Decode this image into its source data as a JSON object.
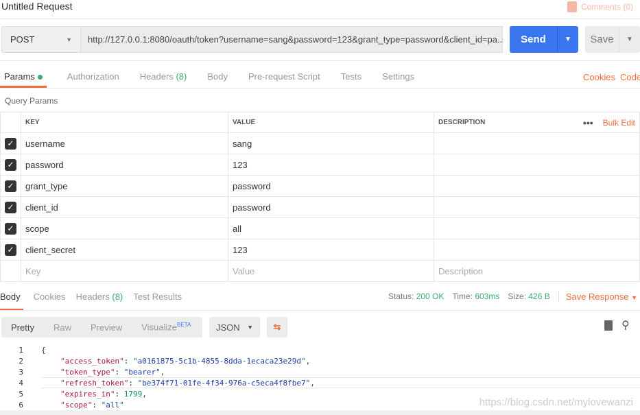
{
  "title": "Untitled Request",
  "comments": "Comments (0)",
  "request": {
    "method": "POST",
    "url": "http://127.0.0.1:8080/oauth/token?username=sang&password=123&grant_type=password&client_id=pa...",
    "send": "Send",
    "save": "Save"
  },
  "tabs": [
    {
      "label": "Params"
    },
    {
      "label": "Authorization"
    },
    {
      "label": "Headers",
      "count": "(8)"
    },
    {
      "label": "Body"
    },
    {
      "label": "Pre-request Script"
    },
    {
      "label": "Tests"
    },
    {
      "label": "Settings"
    }
  ],
  "links": {
    "cookies": "Cookies",
    "code": "Code"
  },
  "query_params_label": "Query Params",
  "table": {
    "headers": [
      "KEY",
      "VALUE",
      "DESCRIPTION"
    ],
    "bulk_edit": "Bulk Edit",
    "rows": [
      {
        "key": "username",
        "value": "sang"
      },
      {
        "key": "password",
        "value": "123"
      },
      {
        "key": "grant_type",
        "value": "password"
      },
      {
        "key": "client_id",
        "value": "password"
      },
      {
        "key": "scope",
        "value": "all"
      },
      {
        "key": "client_secret",
        "value": "123"
      }
    ],
    "placeholders": {
      "key": "Key",
      "value": "Value",
      "description": "Description"
    }
  },
  "response": {
    "tabs": [
      "Body",
      "Cookies",
      "Headers",
      "Test Results"
    ],
    "headers_count": "(8)",
    "status_label": "Status:",
    "status": "200 OK",
    "time_label": "Time:",
    "time": "603ms",
    "size_label": "Size:",
    "size": "426 B",
    "save_response": "Save Response",
    "views": [
      "Pretty",
      "Raw",
      "Preview",
      "Visualize"
    ],
    "beta": "BETA",
    "format": "JSON",
    "lines": [
      [
        "1",
        "{"
      ],
      [
        "2",
        "\"access_token\"",
        ": ",
        "\"a0161875-5c1b-4855-8dda-1ecaca23e29d\"",
        ","
      ],
      [
        "3",
        "\"token_type\"",
        ": ",
        "\"bearer\"",
        ","
      ],
      [
        "4",
        "\"refresh_token\"",
        ": ",
        "\"be374f71-01fe-4f34-976a-c5eca4f8fbe7\"",
        ","
      ],
      [
        "5",
        "\"expires_in\"",
        ": ",
        "1799",
        ","
      ],
      [
        "6",
        "\"scope\"",
        ": ",
        "\"all\"",
        ""
      ]
    ]
  },
  "watermark": "https://blog.csdn.net/mylovewanzi"
}
